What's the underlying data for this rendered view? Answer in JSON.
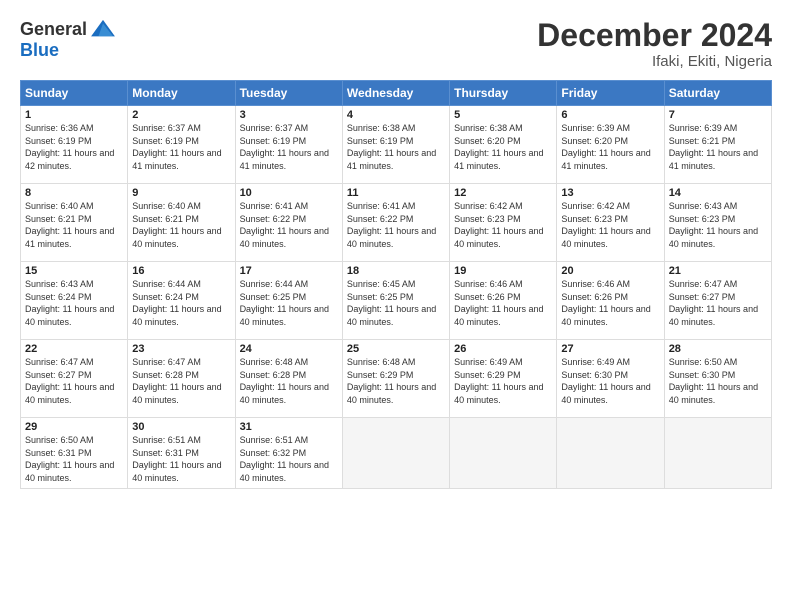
{
  "logo": {
    "general": "General",
    "blue": "Blue"
  },
  "header": {
    "month": "December 2024",
    "location": "Ifaki, Ekiti, Nigeria"
  },
  "weekdays": [
    "Sunday",
    "Monday",
    "Tuesday",
    "Wednesday",
    "Thursday",
    "Friday",
    "Saturday"
  ],
  "weeks": [
    [
      {
        "day": "1",
        "sunrise": "6:36 AM",
        "sunset": "6:19 PM",
        "daylight": "11 hours and 42 minutes."
      },
      {
        "day": "2",
        "sunrise": "6:37 AM",
        "sunset": "6:19 PM",
        "daylight": "11 hours and 41 minutes."
      },
      {
        "day": "3",
        "sunrise": "6:37 AM",
        "sunset": "6:19 PM",
        "daylight": "11 hours and 41 minutes."
      },
      {
        "day": "4",
        "sunrise": "6:38 AM",
        "sunset": "6:19 PM",
        "daylight": "11 hours and 41 minutes."
      },
      {
        "day": "5",
        "sunrise": "6:38 AM",
        "sunset": "6:20 PM",
        "daylight": "11 hours and 41 minutes."
      },
      {
        "day": "6",
        "sunrise": "6:39 AM",
        "sunset": "6:20 PM",
        "daylight": "11 hours and 41 minutes."
      },
      {
        "day": "7",
        "sunrise": "6:39 AM",
        "sunset": "6:21 PM",
        "daylight": "11 hours and 41 minutes."
      }
    ],
    [
      {
        "day": "8",
        "sunrise": "6:40 AM",
        "sunset": "6:21 PM",
        "daylight": "11 hours and 41 minutes."
      },
      {
        "day": "9",
        "sunrise": "6:40 AM",
        "sunset": "6:21 PM",
        "daylight": "11 hours and 40 minutes."
      },
      {
        "day": "10",
        "sunrise": "6:41 AM",
        "sunset": "6:22 PM",
        "daylight": "11 hours and 40 minutes."
      },
      {
        "day": "11",
        "sunrise": "6:41 AM",
        "sunset": "6:22 PM",
        "daylight": "11 hours and 40 minutes."
      },
      {
        "day": "12",
        "sunrise": "6:42 AM",
        "sunset": "6:23 PM",
        "daylight": "11 hours and 40 minutes."
      },
      {
        "day": "13",
        "sunrise": "6:42 AM",
        "sunset": "6:23 PM",
        "daylight": "11 hours and 40 minutes."
      },
      {
        "day": "14",
        "sunrise": "6:43 AM",
        "sunset": "6:23 PM",
        "daylight": "11 hours and 40 minutes."
      }
    ],
    [
      {
        "day": "15",
        "sunrise": "6:43 AM",
        "sunset": "6:24 PM",
        "daylight": "11 hours and 40 minutes."
      },
      {
        "day": "16",
        "sunrise": "6:44 AM",
        "sunset": "6:24 PM",
        "daylight": "11 hours and 40 minutes."
      },
      {
        "day": "17",
        "sunrise": "6:44 AM",
        "sunset": "6:25 PM",
        "daylight": "11 hours and 40 minutes."
      },
      {
        "day": "18",
        "sunrise": "6:45 AM",
        "sunset": "6:25 PM",
        "daylight": "11 hours and 40 minutes."
      },
      {
        "day": "19",
        "sunrise": "6:46 AM",
        "sunset": "6:26 PM",
        "daylight": "11 hours and 40 minutes."
      },
      {
        "day": "20",
        "sunrise": "6:46 AM",
        "sunset": "6:26 PM",
        "daylight": "11 hours and 40 minutes."
      },
      {
        "day": "21",
        "sunrise": "6:47 AM",
        "sunset": "6:27 PM",
        "daylight": "11 hours and 40 minutes."
      }
    ],
    [
      {
        "day": "22",
        "sunrise": "6:47 AM",
        "sunset": "6:27 PM",
        "daylight": "11 hours and 40 minutes."
      },
      {
        "day": "23",
        "sunrise": "6:47 AM",
        "sunset": "6:28 PM",
        "daylight": "11 hours and 40 minutes."
      },
      {
        "day": "24",
        "sunrise": "6:48 AM",
        "sunset": "6:28 PM",
        "daylight": "11 hours and 40 minutes."
      },
      {
        "day": "25",
        "sunrise": "6:48 AM",
        "sunset": "6:29 PM",
        "daylight": "11 hours and 40 minutes."
      },
      {
        "day": "26",
        "sunrise": "6:49 AM",
        "sunset": "6:29 PM",
        "daylight": "11 hours and 40 minutes."
      },
      {
        "day": "27",
        "sunrise": "6:49 AM",
        "sunset": "6:30 PM",
        "daylight": "11 hours and 40 minutes."
      },
      {
        "day": "28",
        "sunrise": "6:50 AM",
        "sunset": "6:30 PM",
        "daylight": "11 hours and 40 minutes."
      }
    ],
    [
      {
        "day": "29",
        "sunrise": "6:50 AM",
        "sunset": "6:31 PM",
        "daylight": "11 hours and 40 minutes."
      },
      {
        "day": "30",
        "sunrise": "6:51 AM",
        "sunset": "6:31 PM",
        "daylight": "11 hours and 40 minutes."
      },
      {
        "day": "31",
        "sunrise": "6:51 AM",
        "sunset": "6:32 PM",
        "daylight": "11 hours and 40 minutes."
      },
      null,
      null,
      null,
      null
    ]
  ],
  "labels": {
    "sunrise": "Sunrise:",
    "sunset": "Sunset:",
    "daylight": "Daylight:"
  }
}
